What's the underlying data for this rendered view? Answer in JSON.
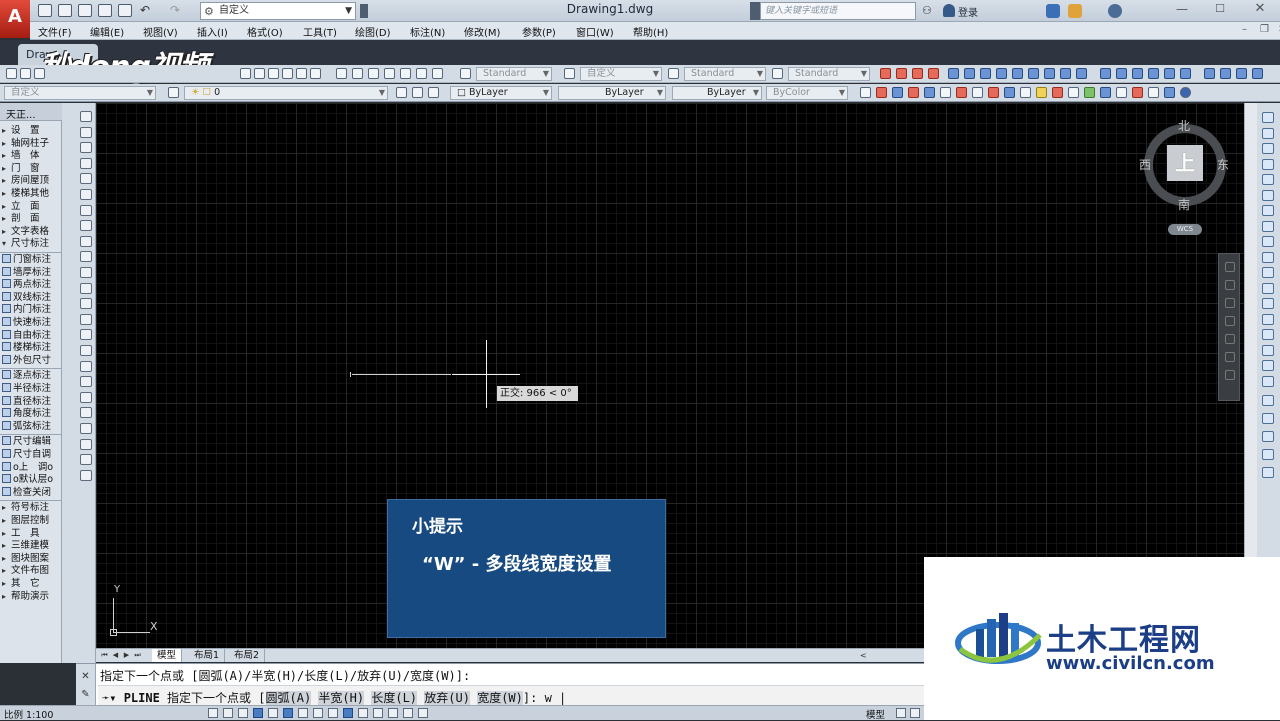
{
  "titlebar": {
    "workspace": "自定义",
    "document_title": "Drawing1.dwg",
    "search_placeholder": "键入关键字或短语",
    "login": "登录"
  },
  "menu": [
    "文件(F)",
    "编辑(E)",
    "视图(V)",
    "插入(I)",
    "格式(O)",
    "工具(T)",
    "绘图(D)",
    "标注(N)",
    "修改(M)",
    "参数(P)",
    "窗口(W)",
    "帮助(H)"
  ],
  "doc_tab": "Draw",
  "watermark": "秒dong视频",
  "toolbar1": {
    "text_style": "Standard",
    "dim_style": "自定义",
    "table_style": "Standard",
    "multileader_style": "Standard"
  },
  "toolbar2": {
    "workspace": "自定义",
    "layer": "0",
    "color": "ByLayer",
    "linetype": "ByLayer",
    "lineweight": "ByLayer",
    "plotstyle": "ByColor"
  },
  "palette": {
    "title": "天正...",
    "items": [
      "设　置",
      "轴网柱子",
      "墙　体",
      "门　窗",
      "房间屋顶",
      "楼梯其他",
      "立　面",
      "剖　面",
      "文字表格",
      "尺寸标注",
      "门窗标注",
      "墙厚标注",
      "两点标注",
      "双线标注",
      "内门标注",
      "快速标注",
      "自由标注",
      "楼梯标注",
      "外包尺寸",
      "逐点标注",
      "半径标注",
      "直径标注",
      "角度标注",
      "弧弦标注",
      "尺寸编辑",
      "尺寸自调",
      "o上　调o",
      "o默认层o",
      "检查关闭",
      "符号标注",
      "图层控制",
      "工　具",
      "三维建模",
      "图块图案",
      "文件布图",
      "其　它",
      "帮助演示"
    ]
  },
  "viewcube": {
    "north": "北",
    "south": "南",
    "east": "东",
    "west": "西",
    "face": "上",
    "ucs": "WCS"
  },
  "drawing": {
    "tooltip": "正交: 966 < 0°",
    "ucs_x": "X",
    "ucs_y": "Y"
  },
  "tip": {
    "title": "小提示",
    "body": "“W” - 多段线宽度设置"
  },
  "layout_tabs": [
    "模型",
    "布局1",
    "布局2"
  ],
  "command": {
    "history": "指定下一个点或 [圆弧(A)/半宽(H)/长度(L)/放弃(U)/宽度(W)]:",
    "prompt_cmd": "PLINE",
    "prompt_text": "指定下一个点或 [",
    "options": [
      "圆弧(A)",
      "半宽(H)",
      "长度(L)",
      "放弃(U)",
      "宽度(W)"
    ],
    "input": "w"
  },
  "status": {
    "scale": "比例 1:100",
    "model": "模型"
  },
  "logo": {
    "name": "土木工程网",
    "url": "www.civilcn.com"
  }
}
